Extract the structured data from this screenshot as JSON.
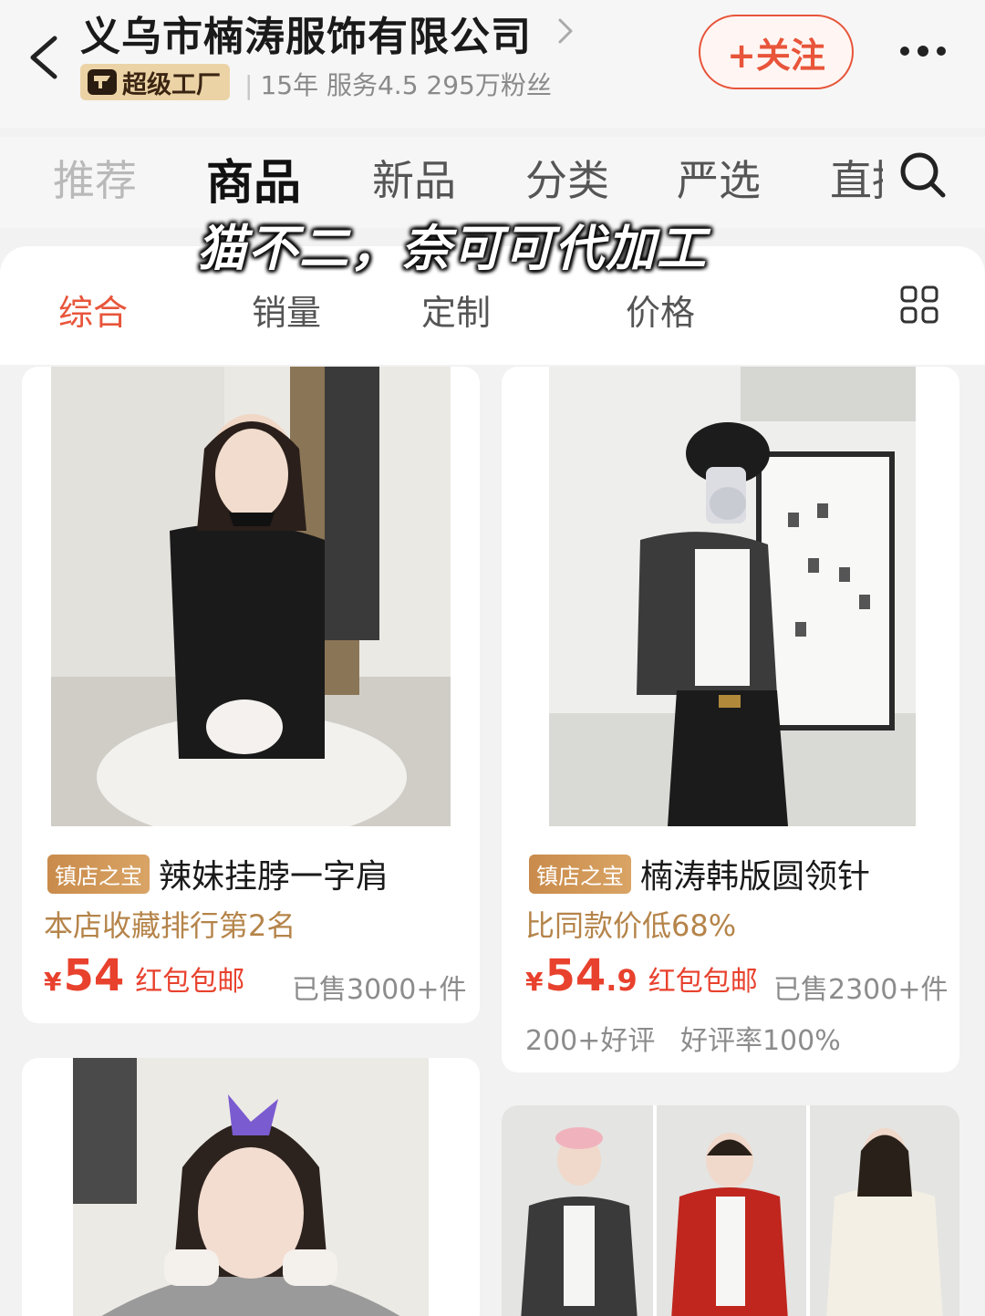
{
  "header": {
    "shop_name": "义乌市楠涛服饰有限公司",
    "badge_label": "超级工厂",
    "years": "15年",
    "service": "服务4.5",
    "fans": "295万粉丝",
    "follow_label": "+关注"
  },
  "top_tabs": [
    {
      "label": "推荐"
    },
    {
      "label": "商品"
    },
    {
      "label": "新品"
    },
    {
      "label": "分类"
    },
    {
      "label": "严选"
    },
    {
      "label": "直播"
    }
  ],
  "overlay_caption": "猫不二，奈可可代加工",
  "sort_bar": [
    {
      "label": "综合"
    },
    {
      "label": "销量"
    },
    {
      "label": "定制"
    },
    {
      "label": "价格"
    }
  ],
  "products": [
    {
      "tag": "镇店之宝",
      "title": "辣妹挂脖一字肩",
      "subline": "本店收藏排行第2名",
      "currency": "¥",
      "price_int": "54",
      "price_dec": "",
      "promo": "红包包邮",
      "sold": "已售3000+件"
    },
    {
      "tag": "镇店之宝",
      "title": "楠涛韩版圆领针",
      "subline": "比同款价低68%",
      "currency": "¥",
      "price_int": "54",
      "price_dec": ".9",
      "promo": "红包包邮",
      "sold": "已售2300+件",
      "reviews": "200+好评",
      "rating": "好评率100%"
    }
  ],
  "colors": {
    "accent": "#e8553a",
    "price": "#e8412d",
    "gold_text": "#b5844a",
    "badge_bg": "#ecd3a6"
  },
  "icons": [
    "back-icon",
    "chevron-right-icon",
    "factory-badge-icon",
    "more-icon",
    "search-icon",
    "grid-view-icon"
  ]
}
